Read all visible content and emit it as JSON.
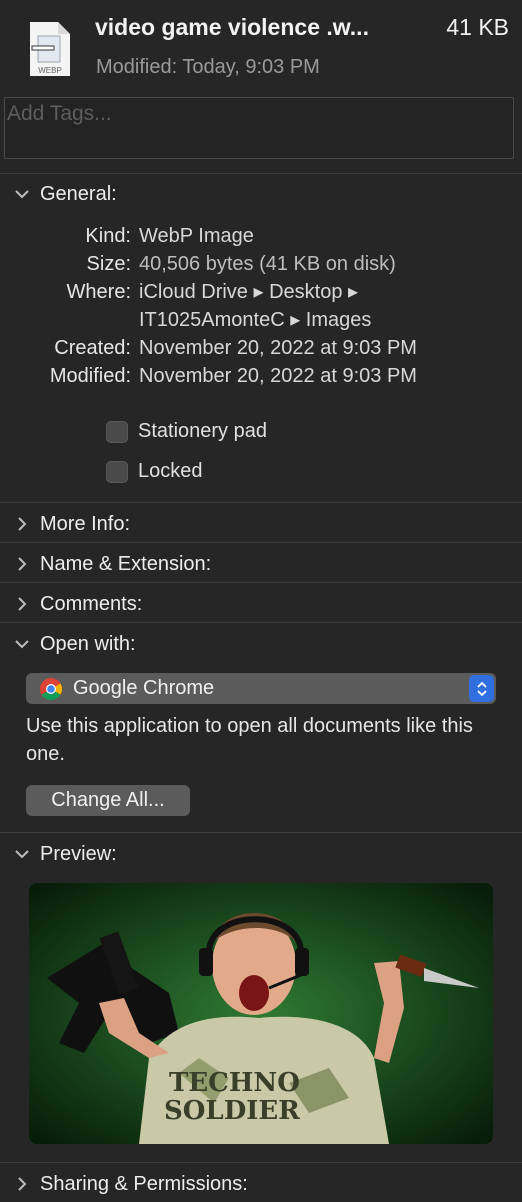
{
  "header": {
    "file_name": "video game violence .w...",
    "file_size": "41 KB",
    "modified_label": "Modified:",
    "modified_value": "Today, 9:03 PM",
    "icon_label": "WEBP"
  },
  "tags": {
    "placeholder": "Add Tags..."
  },
  "general": {
    "title": "General:",
    "rows": [
      {
        "label": "Kind:",
        "value": "WebP Image"
      },
      {
        "label": "Size:",
        "value": "40,506 bytes (41 KB on disk)"
      },
      {
        "label": "Where:",
        "value": "iCloud Drive ▸ Desktop ▸"
      },
      {
        "label": "",
        "value": "IT1025AmonteC ▸ Images"
      },
      {
        "label": "Created:",
        "value": "November 20, 2022 at 9:03 PM"
      },
      {
        "label": "Modified:",
        "value": "November 20, 2022 at 9:03 PM"
      }
    ],
    "stationery": "Stationery pad",
    "locked": "Locked"
  },
  "sections": {
    "more_info": "More Info:",
    "name_ext": "Name & Extension:",
    "comments": "Comments:",
    "open_with": "Open with:",
    "preview": "Preview:",
    "sharing": "Sharing & Permissions:"
  },
  "open_with": {
    "app": "Google Chrome",
    "description": "Use this application to open all documents like this one.",
    "change_all": "Change All..."
  },
  "preview_image": {
    "shirt_text_line1": "TECHNO",
    "shirt_text_line2": "SOLDIER"
  },
  "colors": {
    "background": "#262626",
    "accent": "#2f6fe0",
    "control": "#5b5b5b"
  }
}
